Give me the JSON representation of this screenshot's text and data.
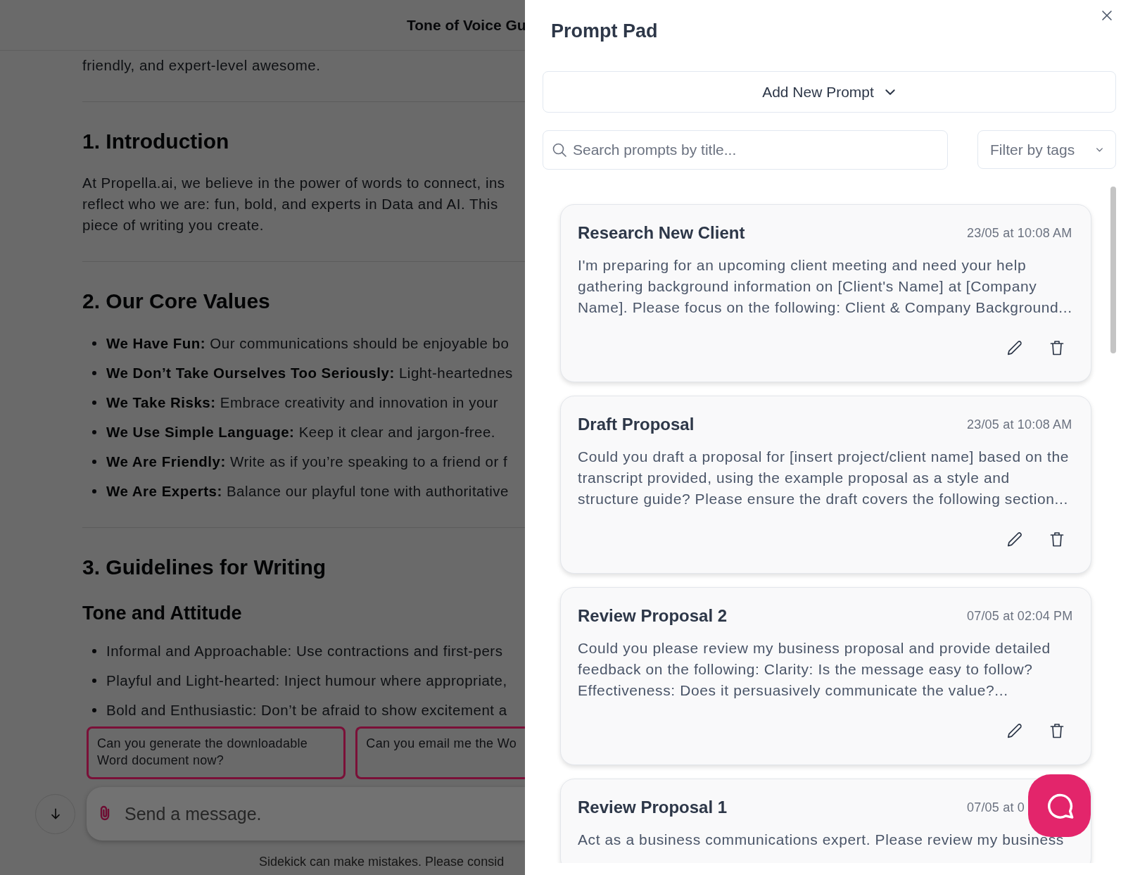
{
  "document": {
    "title": "Tone of Voice Gu",
    "blocks": [
      {
        "kind": "paragraph",
        "lines": [
          "friendly, and expert-level awesome."
        ]
      },
      {
        "kind": "rule"
      },
      {
        "kind": "heading",
        "text": "1. Introduction"
      },
      {
        "kind": "paragraph",
        "lines": [
          "At Propella.ai, we believe in the power of words to connect, ins",
          "reflect who we are: fun, bold, and experts in Data and AI. This",
          "piece of writing you create."
        ]
      },
      {
        "kind": "rule"
      },
      {
        "kind": "heading",
        "text": "2. Our Core Values"
      },
      {
        "kind": "list",
        "items": [
          "**We Have Fun:** Our communications should be enjoyable bo",
          "**We Don’t Take Ourselves Too Seriously:** Light-heartednes",
          "**We Take Risks:** Embrace creativity and innovation in your",
          "**We Use Simple Language:** Keep it clear and jargon-free.",
          "**We Are Friendly:** Write as if you’re speaking to a friend or f",
          "**We Are Experts:** Balance our playful tone with authoritative"
        ]
      },
      {
        "kind": "rule"
      },
      {
        "kind": "heading",
        "text": "3. Guidelines for Writing"
      },
      {
        "kind": "subheading",
        "text": "Tone and Attitude"
      },
      {
        "kind": "list",
        "items": [
          "Informal and Approachable: Use contractions and first-pers",
          "Playful and Light-hearted: Inject humour where appropriate,",
          "Bold and Enthusiastic: Don’t be afraid to show excitement a"
        ]
      }
    ]
  },
  "chat": {
    "suggestions": [
      "Can you generate the downloadable Word document now?",
      "Can you email me the Wo"
    ],
    "message": {
      "placeholder": "Send a message."
    },
    "disclaimer": "Sidekick can make mistakes. Please consid"
  },
  "prompt_pad": {
    "title": "Prompt Pad",
    "add_button": "Add New Prompt",
    "search": {
      "placeholder": "Search prompts by title..."
    },
    "filter": {
      "label": "Filter by tags"
    },
    "prompts": [
      {
        "title": "Research New Client",
        "date": "23/05 at 10:08 AM",
        "body": "I'm preparing for an upcoming client meeting and need your help gathering background information on [Client's Name] at [Company Name]. Please focus on the following: Client & Company Background...",
        "actions": [
          {
            "kind": "edit"
          },
          {
            "kind": "delete"
          }
        ]
      },
      {
        "title": "Draft Proposal",
        "date": "23/05 at 10:08 AM",
        "body": "Could you draft a proposal for [insert project/client name] based on the transcript provided, using the example proposal as a style and structure guide? Please ensure the draft covers the following section...",
        "actions": [
          {
            "kind": "edit"
          },
          {
            "kind": "delete"
          }
        ]
      },
      {
        "title": "Review Proposal 2",
        "date": "07/05 at 02:04 PM",
        "body": "Could you please review my business proposal and provide detailed feedback on the following: Clarity: Is the message easy to follow? Effectiveness: Does it persuasively communicate the value?...",
        "actions": [
          {
            "kind": "edit"
          },
          {
            "kind": "delete"
          }
        ]
      },
      {
        "title": "Review Proposal 1",
        "date": "07/05 at 0",
        "body": "Act as a business communications expert. Please review my business"
      }
    ]
  }
}
